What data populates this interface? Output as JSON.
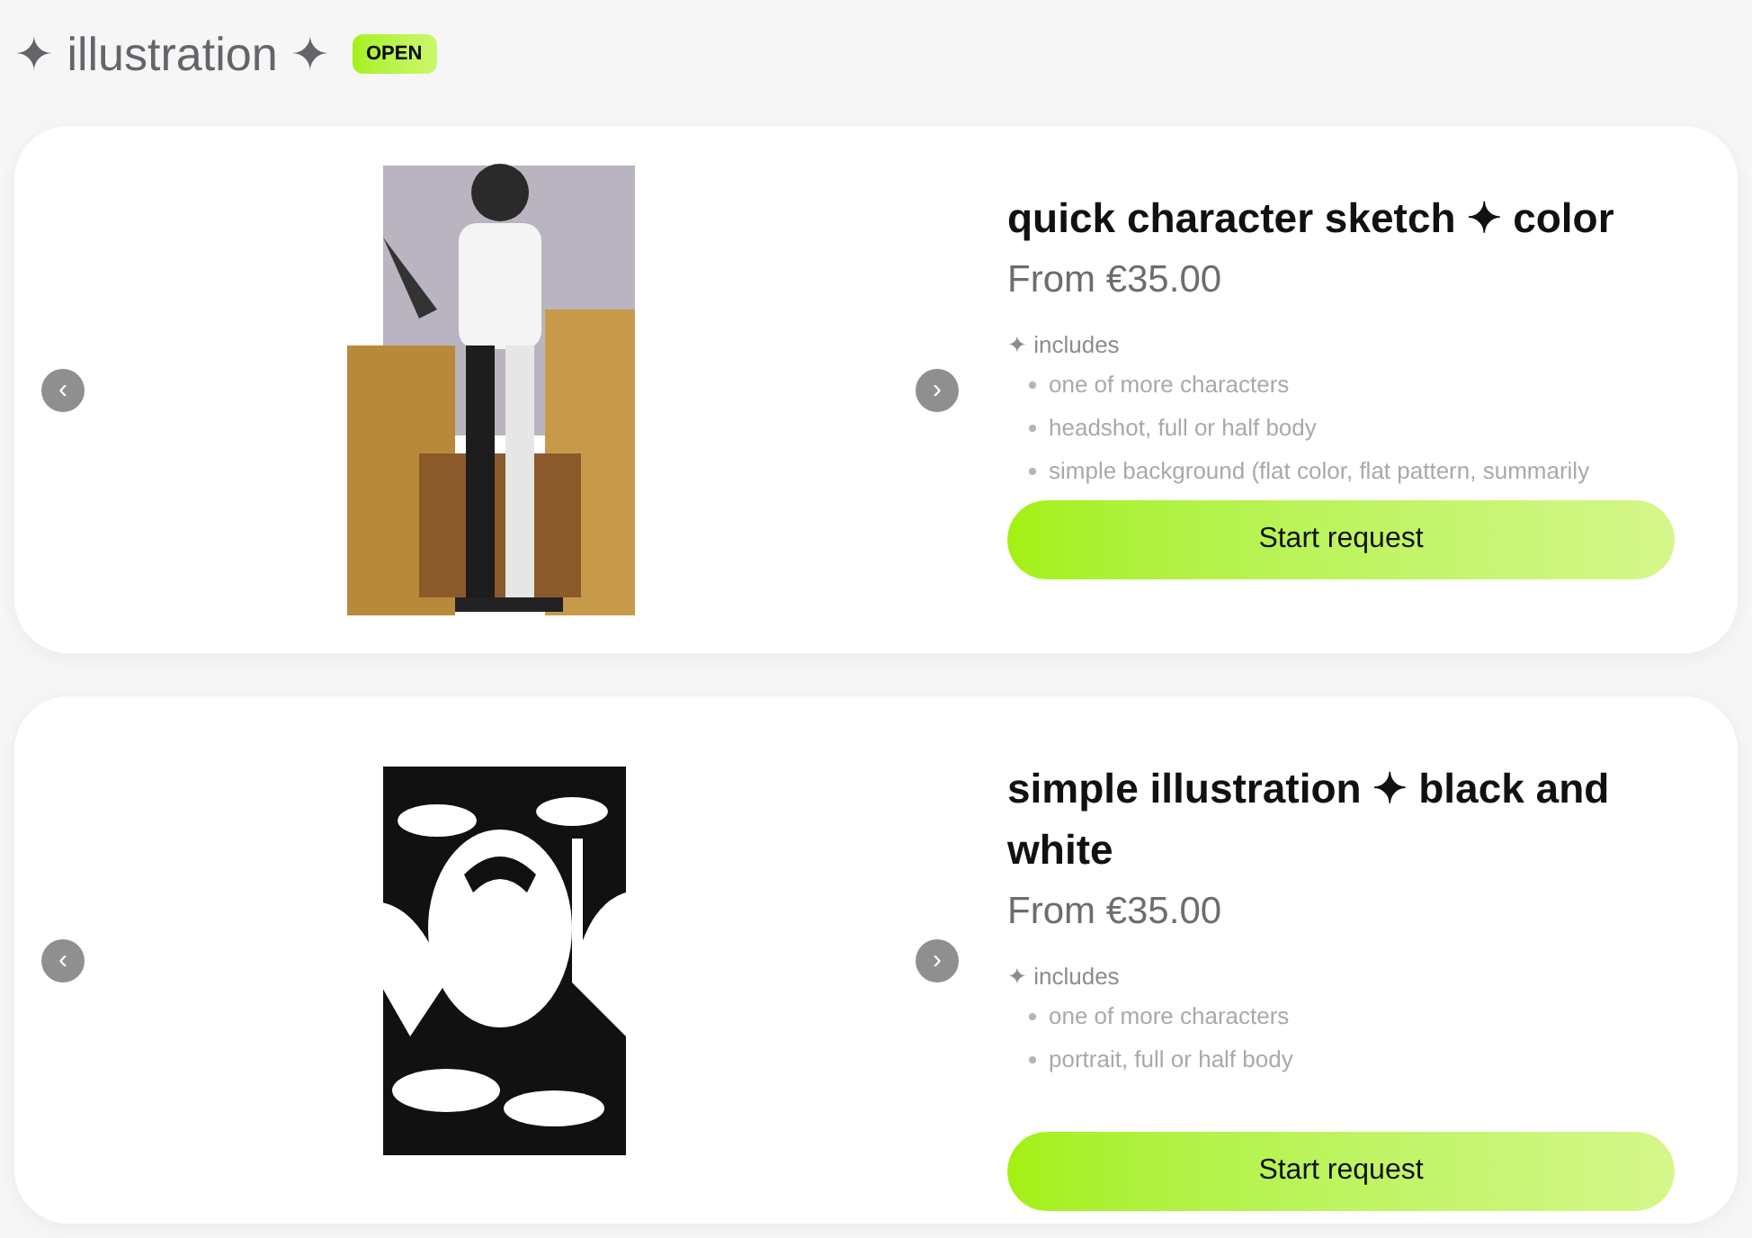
{
  "section": {
    "title": "✦ illustration ✦",
    "badge": "OPEN"
  },
  "cards": [
    {
      "title": "quick character sketch ✦ color",
      "price": "From €35.00",
      "includes_label": "✦ includes",
      "items": [
        "one of more characters",
        "headshot, full or half body",
        "simple background (flat color, flat pattern, summarily"
      ],
      "button": "Start request",
      "prev": "‹",
      "next": "›"
    },
    {
      "title": "simple illustration ✦ black and white",
      "price": "From €35.00",
      "includes_label": "✦ includes",
      "items": [
        "one of more characters",
        "portrait, full or half body"
      ],
      "button": "Start request",
      "prev": "‹",
      "next": "›"
    }
  ]
}
